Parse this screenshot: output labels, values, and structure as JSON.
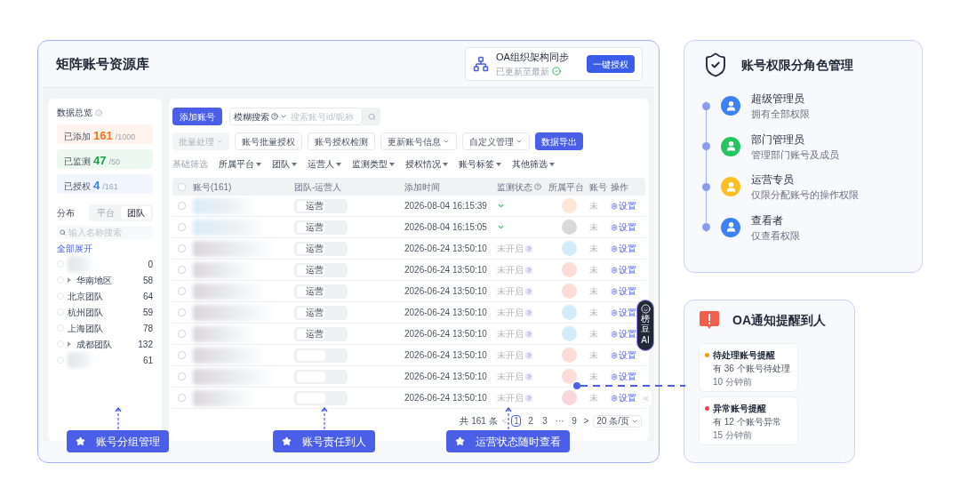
{
  "title": "矩阵账号资源库",
  "oa_sync": {
    "title": "OA组织架构同步",
    "status": "已更新至最新",
    "button": "一键授权"
  },
  "overview": {
    "title": "数据总览",
    "stats": [
      {
        "label": "已添加",
        "value": "161",
        "total": "/1000",
        "color": "#f97316"
      },
      {
        "label": "已监测",
        "value": "47",
        "total": "/50",
        "color": "#16a34a"
      },
      {
        "label": "已授权",
        "value": "4",
        "total": "/161",
        "color": "#3b82f6"
      }
    ]
  },
  "distribution": {
    "title": "分布",
    "tabs": [
      {
        "label": "平台",
        "selected": false
      },
      {
        "label": "团队",
        "selected": true
      }
    ],
    "search_placeholder": "输入名称搜索",
    "expand_all": "全部展开",
    "items": [
      {
        "kind": "blurred",
        "count": "0",
        "checked": false
      },
      {
        "kind": "group",
        "label": "华南地区",
        "count": "58",
        "checked": false
      },
      {
        "kind": "team",
        "label": "北京团队",
        "count": "64",
        "checked": false
      },
      {
        "kind": "team",
        "label": "杭州团队",
        "count": "59",
        "checked": false
      },
      {
        "kind": "team",
        "label": "上海团队",
        "count": "78",
        "checked": false
      },
      {
        "kind": "group",
        "label": "成都团队",
        "count": "132",
        "checked": false
      },
      {
        "kind": "blurred",
        "count": "61",
        "checked": false
      }
    ]
  },
  "toolbar": {
    "add_button": "添加账号",
    "search_mode": "模糊搜索",
    "search_placeholder": "搜索账号id/昵称",
    "actions": [
      {
        "kind": "dropdown",
        "label": "批量处理",
        "disabled": true
      },
      {
        "kind": "button",
        "label": "账号批量授权",
        "disabled": false
      },
      {
        "kind": "button",
        "label": "账号授权检测",
        "disabled": false
      },
      {
        "kind": "dropdown",
        "label": "更新账号信息",
        "disabled": false
      },
      {
        "kind": "dropdown",
        "label": "自定义管理",
        "disabled": false
      },
      {
        "kind": "primary",
        "label": "数据导出",
        "disabled": false
      }
    ],
    "filter_label": "基础筛选",
    "filters": [
      "所属平台",
      "团队",
      "运营人",
      "监测类型",
      "授权情况",
      "账号标签",
      "其他筛选"
    ]
  },
  "table": {
    "all_checked": false,
    "columns": [
      "账号(161)",
      "团队-运营人",
      "添加时间",
      "监测状态",
      "所属平台",
      "账号",
      "操作"
    ],
    "rows": [
      {
        "checked": false,
        "team_tag": "运营",
        "time": "2026-08-04 16:15:39",
        "kind": "monitored",
        "color": "#fde6d6",
        "col_6": "未",
        "action": "设置"
      },
      {
        "checked": false,
        "team_tag": "运营",
        "time": "2026-08-04 16:15:05",
        "kind": "monitored",
        "color": "#d9d9dc",
        "col_6": "未",
        "action": "设置"
      },
      {
        "checked": false,
        "team_tag": "运营",
        "time": "2026-06-24 13:50:10",
        "kind": "off",
        "status_text": "未开启",
        "color": "#d4ecfa",
        "col_6": "未",
        "action": "设置"
      },
      {
        "checked": false,
        "team_tag": "运营",
        "time": "2026-06-24 13:50:10",
        "kind": "off",
        "status_text": "未开启",
        "color": "#fcdcd7",
        "col_6": "未",
        "action": "设置"
      },
      {
        "checked": false,
        "team_tag": "运营",
        "time": "2026-06-24 13:50:10",
        "kind": "off",
        "status_text": "未开启",
        "color": "#fcdcd7",
        "col_6": "未",
        "action": "设置"
      },
      {
        "checked": false,
        "team_tag": "运营",
        "time": "2026-06-24 13:50:10",
        "kind": "off",
        "status_text": "未开启",
        "color": "#d4ecfa",
        "col_6": "未",
        "action": "设置"
      },
      {
        "checked": false,
        "team_tag": "运营",
        "time": "2026-06-24 13:50:10",
        "kind": "off",
        "status_text": "未开启",
        "color": "#d4ecfa",
        "col_6": "未",
        "action": "设置"
      },
      {
        "checked": false,
        "time": "2026-06-24 13:50:10",
        "kind": "off",
        "status_text": "未开启",
        "color": "#fcdcd7",
        "col_6": "未",
        "action": "设置"
      },
      {
        "checked": false,
        "time": "2026-06-24 13:50:10",
        "kind": "off",
        "status_text": "未开启",
        "color": "#fcdcd7",
        "col_6": "未",
        "action": "设置"
      },
      {
        "checked": false,
        "time": "2026-06-24 13:50:10",
        "kind": "off",
        "status_text": "未开启",
        "color": "#f9d5dc",
        "col_6": "未",
        "action": "设置"
      }
    ]
  },
  "pagination": {
    "total": "共 161 条",
    "prev": "<",
    "pages": [
      {
        "label": "1",
        "selected": true
      },
      {
        "label": "2",
        "selected": false
      },
      {
        "label": "3",
        "selected": false
      },
      {
        "label": "···",
        "selected": false
      },
      {
        "label": "9",
        "selected": false
      }
    ],
    "next": ">",
    "page_size": "20 条/页"
  },
  "ai_button": {
    "label": "榜豆",
    "tag": "AI"
  },
  "callouts": [
    "账号分组管理",
    "账号责任到人",
    "运营状态随时查看"
  ],
  "roles_card": {
    "title": "账号权限分角色管理",
    "roles": [
      {
        "name": "超级管理员",
        "desc": "拥有全部权限",
        "color": "#3b82f6"
      },
      {
        "name": "部门管理员",
        "desc": "管理部门账号及成员",
        "color": "#22c55e"
      },
      {
        "name": "运营专员",
        "desc": "仅限分配账号的操作权限",
        "color": "#fbbf24"
      },
      {
        "name": "查看者",
        "desc": "仅查看权限",
        "color": "#3b82f6"
      }
    ]
  },
  "notify_card": {
    "title": "OA通知提醒到人",
    "items": [
      {
        "title": "待处理账号提醒",
        "text": "有 36 个账号待处理",
        "time": "10 分钟前",
        "color": "#f59e0b"
      },
      {
        "title": "异常账号提醒",
        "text": "有 12 个账号异常",
        "time": "15 分钟前",
        "color": "#ef4444"
      }
    ]
  }
}
